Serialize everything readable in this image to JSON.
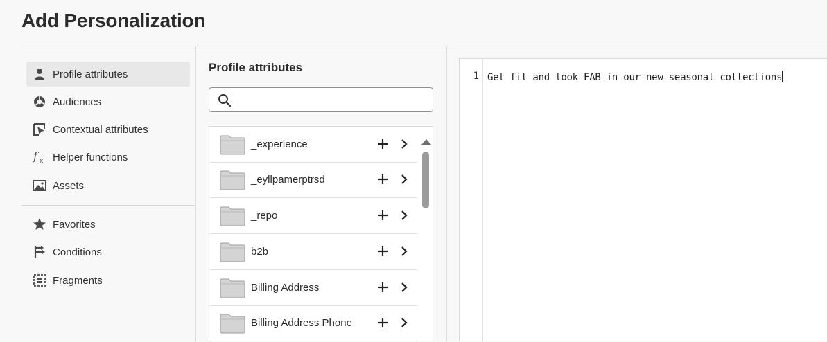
{
  "header": {
    "title": "Add Personalization"
  },
  "nav": {
    "items": [
      {
        "label": "Profile attributes",
        "icon": "person-icon",
        "selected": true
      },
      {
        "label": "Audiences",
        "icon": "audiences-icon",
        "selected": false
      },
      {
        "label": "Contextual attributes",
        "icon": "contextual-icon",
        "selected": false
      },
      {
        "label": "Helper functions",
        "icon": "function-icon",
        "selected": false
      },
      {
        "label": "Assets",
        "icon": "image-icon",
        "selected": false
      },
      {
        "label": "Favorites",
        "icon": "star-icon",
        "selected": false
      },
      {
        "label": "Conditions",
        "icon": "branch-icon",
        "selected": false
      },
      {
        "label": "Fragments",
        "icon": "fragment-icon",
        "selected": false
      }
    ]
  },
  "panel": {
    "title": "Profile attributes",
    "search": {
      "value": "",
      "placeholder": ""
    },
    "rows": [
      {
        "label": "_experience"
      },
      {
        "label": "_eyllpamerptrsd"
      },
      {
        "label": "_repo"
      },
      {
        "label": "b2b"
      },
      {
        "label": "Billing Address"
      },
      {
        "label": "Billing Address Phone"
      }
    ]
  },
  "editor": {
    "line_number": "1",
    "code": "Get fit and look FAB in our new seasonal collections"
  },
  "colors": {
    "icon": "#4b4b4b",
    "folder": "#d4d4d4",
    "selected_bg": "#e8e8e8"
  }
}
